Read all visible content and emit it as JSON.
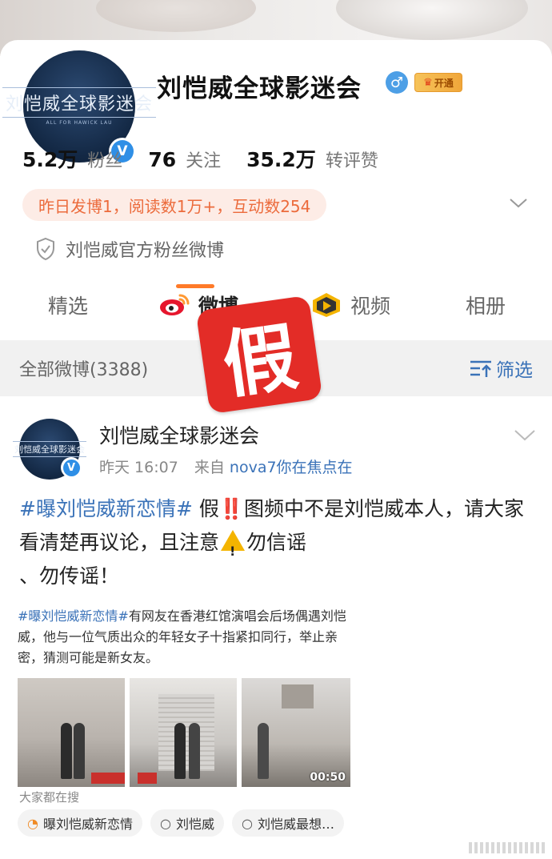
{
  "profile": {
    "avatar_title": "刘恺威全球影迷会",
    "avatar_sub": "ALL FOR HAWICK LAU",
    "name": "刘恺威全球影迷会",
    "gender_symbol": "♂",
    "vip_label": "开通",
    "stats": [
      {
        "num": "5.2万",
        "label": "粉丝"
      },
      {
        "num": "76",
        "label": "关注"
      },
      {
        "num": "35.2万",
        "label": "转评赞"
      }
    ],
    "activity": "昨日发博1，阅读数1万+，互动数254",
    "official": "刘恺威官方粉丝微博"
  },
  "tabs": {
    "selected": "精选",
    "weibo": "微博",
    "video": "视频",
    "album": "相册"
  },
  "filter_bar": {
    "all": "全部微博(3388)",
    "filter": "筛选"
  },
  "post": {
    "author": "刘恺威全球影迷会",
    "time": "昨天 16:07",
    "source_prefix": "来自",
    "source": "nova7你在焦点在",
    "hashtag": "#曝刘恺威新恋情#",
    "text_a": " 假",
    "excl": "‼️",
    "text_b": "图频中不是刘恺威本人，请大家看清楚再议论，且注意",
    "text_c": "勿信谣",
    "text_d": "、勿传谣！",
    "embed_hashtag": "#曝刘恺威新恋情#",
    "embed_text": "有网友在香港红馆演唱会后场偶遇刘恺威，他与一位气质出众的年轻女子十指紧扣同行，举止亲密，猜测可能是新女友。",
    "video_duration": "00:50",
    "fake_stamp": "假",
    "search_label": "大家都在搜",
    "chips": [
      "曝刘恺威新恋情",
      "刘恺威",
      "刘恺威最想…"
    ]
  },
  "colors": {
    "accent_orange": "#ff7a28",
    "link_blue": "#3a72b8",
    "activity_bg": "#fdece6",
    "activity_text": "#ec6b3c",
    "stamp_red": "#e32c27"
  }
}
